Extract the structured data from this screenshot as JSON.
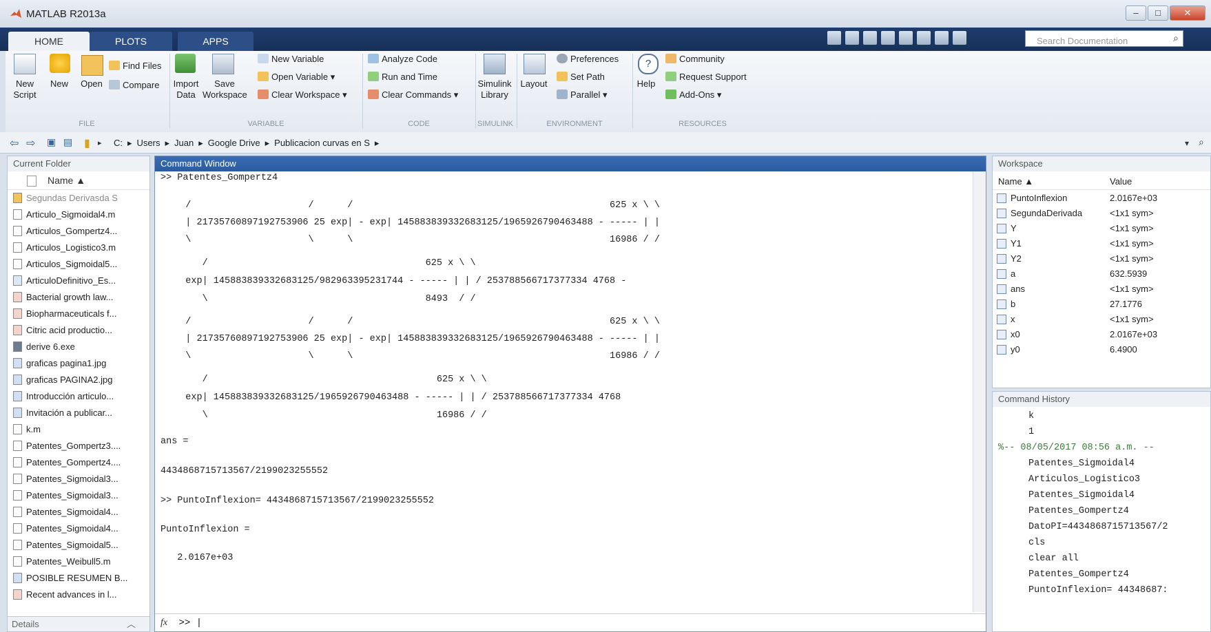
{
  "app": {
    "title": "MATLAB R2013a"
  },
  "window_controls": {
    "minimize": "–",
    "maximize": "□",
    "close": "✕"
  },
  "tabs": [
    "HOME",
    "PLOTS",
    "APPS"
  ],
  "search": {
    "placeholder": "Search Documentation"
  },
  "ribbon": {
    "file": {
      "group": "FILE",
      "new_script": "New\nScript",
      "new": "New",
      "open": "Open",
      "find_files": "Find Files",
      "compare": "Compare"
    },
    "variable": {
      "group": "VARIABLE",
      "import_data": "Import\nData",
      "save_workspace": "Save\nWorkspace",
      "new_variable": "New Variable",
      "open_variable": "Open Variable ▾",
      "clear_workspace": "Clear Workspace ▾"
    },
    "code": {
      "group": "CODE",
      "analyze_code": "Analyze Code",
      "run_and_time": "Run and Time",
      "clear_commands": "Clear Commands ▾"
    },
    "simulink": {
      "group": "SIMULINK",
      "library": "Simulink\nLibrary"
    },
    "environment": {
      "group": "ENVIRONMENT",
      "layout": "Layout",
      "preferences": "Preferences",
      "set_path": "Set Path",
      "parallel": "Parallel ▾"
    },
    "resources": {
      "group": "RESOURCES",
      "help": "Help",
      "community": "Community",
      "request_support": "Request Support",
      "add_ons": "Add-Ons ▾"
    }
  },
  "address": {
    "crumbs": [
      "C:",
      "▸",
      "Users",
      "▸",
      "Juan",
      "▸",
      "Google Drive",
      "▸",
      "Publicacion curvas en S",
      "▸"
    ]
  },
  "current_folder": {
    "title": "Current Folder",
    "column": "Name ▲",
    "items": [
      "Segundas Derivasda S",
      "Articulo_Sigmoidal4.m",
      "Articulos_Gompertz4...",
      "Articulos_Logistico3.m",
      "Articulos_Sigmoidal5...",
      "ArticuloDefinitivo_Es...",
      "Bacterial growth law...",
      "Biopharmaceuticals f...",
      "Citric acid productio...",
      "derive 6.exe",
      "graficas pagina1.jpg",
      "graficas PAGINA2.jpg",
      "Introducción articulo...",
      "Invitación a publicar...",
      "k.m",
      "Patentes_Gompertz3....",
      "Patentes_Gompertz4....",
      "Patentes_Sigmoidal3...",
      "Patentes_Sigmoidal3...",
      "Patentes_Sigmoidal4...",
      "Patentes_Sigmoidal4...",
      "Patentes_Sigmoidal5...",
      "Patentes_Weibull5.m",
      "POSIBLE RESUMEN B...",
      "Recent advances in l..."
    ],
    "details": "Details"
  },
  "command_window": {
    "title": "Command Window",
    "lines": [
      ">> Patentes_Gompertz4",
      "   /                     /      /                                              625 x \\ \\",
      "   | 21735760897192753906 25 exp| - exp| 145883839332683125/1965926790463488 - ----- | |",
      "   \\                     \\      \\                                              16986 / /",
      "      /                                       625 x \\ \\",
      "   exp| 145883839332683125/982963395231744 - ----- | | / 253788566717377334 4768 -",
      "      \\                                       8493  / /",
      "   /                     /      /                                              625 x \\ \\",
      "   | 21735760897192753906 25 exp| - exp| 145883839332683125/1965926790463488 - ----- | |",
      "   \\                     \\      \\                                              16986 / /",
      "      /                                         625 x \\ \\",
      "   exp| 145883839332683125/1965926790463488 - ----- | | / 253788566717377334 4768",
      "      \\                                         16986 / /",
      "ans =",
      "4434868715713567/2199023255552",
      ">> PuntoInflexion= 4434868715713567/2199023255552",
      "PuntoInflexion =",
      "   2.0167e+03"
    ],
    "prompt_fx": "fx",
    "prompt": ">> |"
  },
  "workspace": {
    "title": "Workspace",
    "col_name": "Name ▲",
    "col_value": "Value",
    "rows": [
      {
        "name": "PuntoInflexion",
        "value": "2.0167e+03"
      },
      {
        "name": "SegundaDerivada",
        "value": "<1x1 sym>"
      },
      {
        "name": "Y",
        "value": "<1x1 sym>"
      },
      {
        "name": "Y1",
        "value": "<1x1 sym>"
      },
      {
        "name": "Y2",
        "value": "<1x1 sym>"
      },
      {
        "name": "a",
        "value": "632.5939"
      },
      {
        "name": "ans",
        "value": "<1x1 sym>"
      },
      {
        "name": "b",
        "value": "27.1776"
      },
      {
        "name": "x",
        "value": "<1x1 sym>"
      },
      {
        "name": "x0",
        "value": "2.0167e+03"
      },
      {
        "name": "y0",
        "value": "6.4900"
      }
    ]
  },
  "command_history": {
    "title": "Command History",
    "items": [
      "k",
      "1",
      "%-- 08/05/2017 08:56 a.m. --",
      "Patentes_Sigmoidal4",
      "Articulos_Logistico3",
      "Patentes_Sigmoidal4",
      "Patentes_Gompertz4",
      "DatoPI=4434868715713567/2",
      "cls",
      "clear all",
      "Patentes_Gompertz4",
      "PuntoInflexion= 44348687:"
    ]
  }
}
